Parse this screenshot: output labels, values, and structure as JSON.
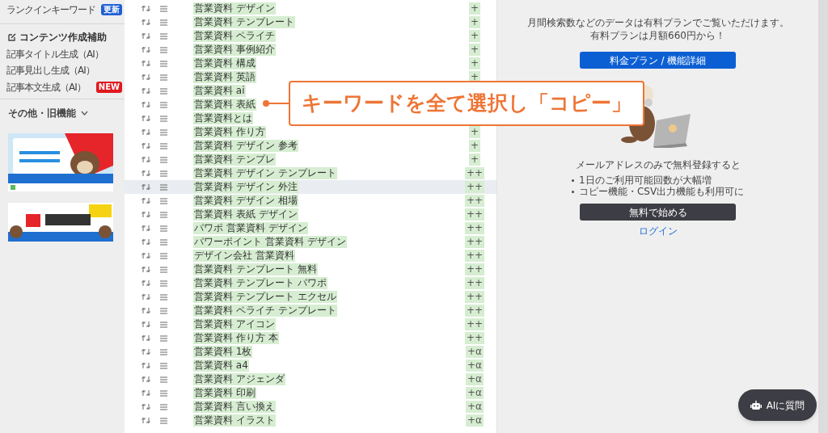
{
  "sidebar": {
    "groups": [
      {
        "items": [
          {
            "kind": "link",
            "label": "ランクインキーワード",
            "badge": {
              "text": "更新",
              "color": "#1f5fd4"
            }
          }
        ]
      },
      {
        "items": [
          {
            "kind": "heading",
            "label": "コンテンツ作成補助"
          },
          {
            "kind": "link",
            "label": "記事タイトル生成（AI）"
          },
          {
            "kind": "link",
            "label": "記事見出し生成（AI）"
          },
          {
            "kind": "link",
            "label": "記事本文生成（AI）",
            "badge": {
              "text": "NEW",
              "color": "#e0191e"
            }
          }
        ]
      },
      {
        "items": [
          {
            "kind": "menu",
            "label": "その他・旧機能",
            "expanded": false
          }
        ]
      }
    ],
    "banners": [
      {
        "kind": "picture"
      },
      {
        "kind": "picture"
      }
    ]
  },
  "keywords": [
    {
      "text": "営業資料 デザイン",
      "grade": "+",
      "hovered": false
    },
    {
      "text": "営業資料 テンプレート",
      "grade": "+",
      "hovered": false
    },
    {
      "text": "営業資料 ペライチ",
      "grade": "+",
      "hovered": false
    },
    {
      "text": "営業資料 事例紹介",
      "grade": "+",
      "hovered": false
    },
    {
      "text": "営業資料 構成",
      "grade": "+",
      "hovered": false
    },
    {
      "text": "営業資料 英語",
      "grade": "+",
      "hovered": false
    },
    {
      "text": "営業資料 ai",
      "hovered": false
    },
    {
      "text": "営業資料 表紙",
      "hovered": false
    },
    {
      "text": "営業資料とは",
      "hovered": false
    },
    {
      "text": "営業資料 作り方",
      "grade": "+",
      "hovered": false
    },
    {
      "text": "営業資料 デザイン 参考",
      "grade": "+",
      "hovered": false
    },
    {
      "text": "営業資料 テンプレ",
      "grade": "+",
      "hovered": false
    },
    {
      "text": "営業資料 デザイン テンプレート",
      "grade": "++",
      "hovered": false
    },
    {
      "text": "営業資料 デザイン 外注",
      "grade": "++",
      "hovered": true
    },
    {
      "text": "営業資料 デザイン 相場",
      "grade": "++",
      "hovered": false
    },
    {
      "text": "営業資料 表紙 デザイン",
      "grade": "++",
      "hovered": false
    },
    {
      "text": "パワポ 営業資料 デザイン",
      "grade": "++",
      "hovered": false
    },
    {
      "text": "パワーポイント 営業資料 デザイン",
      "grade": "++",
      "hovered": false
    },
    {
      "text": "デザイン会社 営業資料",
      "grade": "++",
      "hovered": false
    },
    {
      "text": "営業資料 テンプレート 無料",
      "grade": "++",
      "hovered": false
    },
    {
      "text": "営業資料 テンプレート パワポ",
      "grade": "++",
      "hovered": false
    },
    {
      "text": "営業資料 テンプレート エクセル",
      "grade": "++",
      "hovered": false
    },
    {
      "text": "営業資料 ペライチ テンプレート",
      "grade": "++",
      "hovered": false
    },
    {
      "text": "営業資料 アイコン",
      "grade": "++",
      "hovered": false
    },
    {
      "text": "営業資料 作り方 本",
      "grade": "++",
      "hovered": false
    },
    {
      "text": "営業資料 1枚",
      "grade": "+α",
      "hovered": false
    },
    {
      "text": "営業資料 a4",
      "grade": "+α",
      "hovered": false
    },
    {
      "text": "営業資料 アジェンダ",
      "grade": "+α",
      "hovered": false
    },
    {
      "text": "営業資料 印刷",
      "grade": "+α",
      "hovered": false
    },
    {
      "text": "営業資料 言い換え",
      "grade": "+α",
      "hovered": false
    },
    {
      "text": "営業資料 イラスト",
      "grade": "+α",
      "hovered": false
    }
  ],
  "right_panel": {
    "notice": [
      "月間検索数などのデータは有料プランでご覧いただけます。",
      "有料プランは月額660円から！"
    ],
    "plan_button": "料金プラン / 機能詳細",
    "illustration": {
      "kind": "picture"
    },
    "signup_text": "メールアドレスのみで無料登録すると",
    "benefits": [
      "1日のご利用可能回数が大幅増",
      "コピー機能・CSV出力機能も利用可に"
    ],
    "start_button": "無料で始める",
    "login_link": "ログイン"
  },
  "callout": {
    "text": "キーワードを全て選択し「コピー」"
  },
  "ai_button": {
    "label": "AIに質問"
  }
}
